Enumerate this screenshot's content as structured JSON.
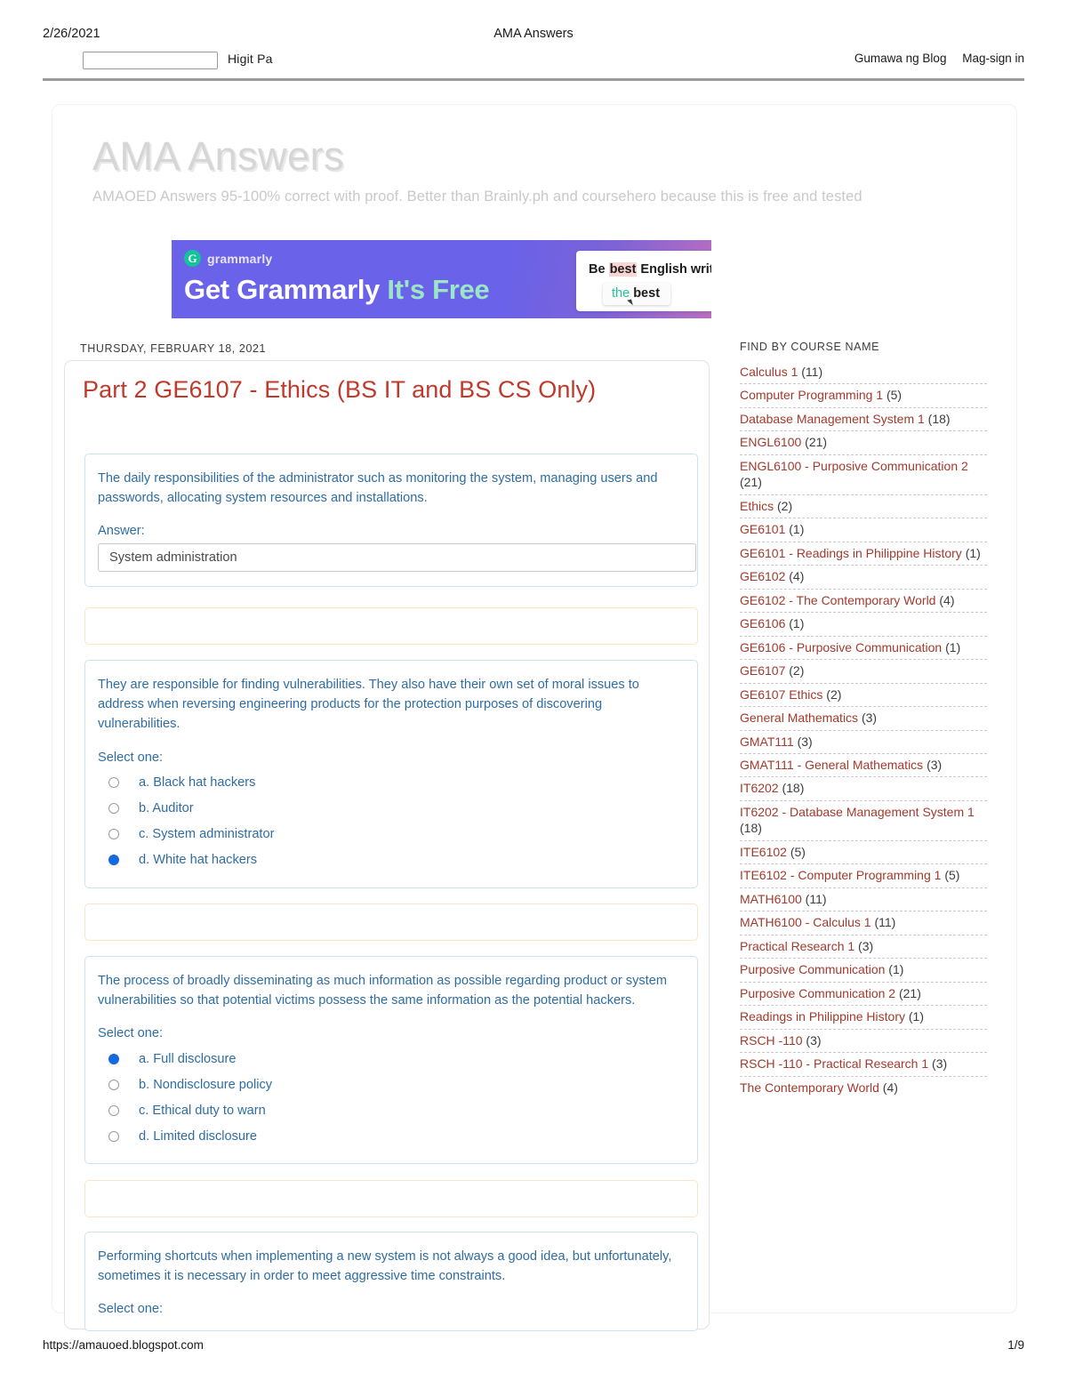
{
  "print_header": {
    "date": "2/26/2021",
    "title": "AMA Answers"
  },
  "navbar": {
    "search_placeholder": "",
    "search_value": "",
    "more_label": "Higit Pa",
    "create_blog_label": "Gumawa ng Blog",
    "sign_in_label": "Mag-sign in"
  },
  "blog": {
    "title": "AMA Answers",
    "description": "AMAOED Answers 95-100% correct with proof. Better than Brainly.ph and coursehero because this is free and tested"
  },
  "ad": {
    "brand": "grammarly",
    "logo_glyph": "G",
    "headline_white": "Get Grammarly",
    "headline_green": "It's Free",
    "card_pre": "Be ",
    "card_highlight": "best",
    "card_post": " English writ",
    "suggest_strike": "the",
    "suggest_bold": "best"
  },
  "post": {
    "date_label": "THURSDAY, FEBRUARY 18, 2021",
    "title": "Part 2 GE6107 - Ethics (BS IT and BS CS Only)",
    "questions": [
      {
        "text": "The daily responsibilities of the administrator such as monitoring the system, managing users and passwords, allocating system resources and installations.",
        "answer_label": "Answer:",
        "answer_value": "System administration",
        "type": "text"
      },
      {
        "text": "They are responsible for finding vulnerabilities. They also have their own set of moral issues to address when reversing engineering products for the protection purposes of discovering vulnerabilities.",
        "select_label": "Select one:",
        "type": "radio",
        "options": [
          {
            "label": "a. Black hat hackers",
            "selected": false
          },
          {
            "label": "b. Auditor",
            "selected": false
          },
          {
            "label": "c. System administrator",
            "selected": false
          },
          {
            "label": "d. White hat hackers",
            "selected": true
          }
        ]
      },
      {
        "text": "The process of broadly disseminating as much information as possible regarding product or system vulnerabilities so that potential victims possess the same information as the potential hackers.",
        "select_label": "Select one:",
        "type": "radio",
        "options": [
          {
            "label": "a. Full disclosure",
            "selected": true
          },
          {
            "label": "b. Nondisclosure policy",
            "selected": false
          },
          {
            "label": "c. Ethical duty to warn",
            "selected": false
          },
          {
            "label": "d. Limited disclosure",
            "selected": false
          }
        ]
      },
      {
        "text": "Performing shortcuts when implementing a new system is not always a good idea, but unfortunately, sometimes it is necessary in order to meet aggressive time constraints.",
        "select_label": "Select one:",
        "type": "radio",
        "options": []
      }
    ]
  },
  "sidebar": {
    "title": "FIND BY COURSE NAME",
    "items": [
      {
        "name": "Calculus 1",
        "count": "(11)"
      },
      {
        "name": "Computer Programming 1",
        "count": "(5)"
      },
      {
        "name": "Database Management System 1",
        "count": "(18)"
      },
      {
        "name": "ENGL6100",
        "count": "(21)"
      },
      {
        "name": "ENGL6100 - Purposive Communication 2",
        "count": "(21)"
      },
      {
        "name": "Ethics",
        "count": "(2)"
      },
      {
        "name": "GE6101",
        "count": "(1)"
      },
      {
        "name": "GE6101 - Readings in Philippine History",
        "count": "(1)"
      },
      {
        "name": "GE6102",
        "count": "(4)"
      },
      {
        "name": "GE6102 - The Contemporary World",
        "count": "(4)"
      },
      {
        "name": "GE6106",
        "count": "(1)"
      },
      {
        "name": "GE6106 - Purposive Communication",
        "count": "(1)"
      },
      {
        "name": "GE6107",
        "count": "(2)"
      },
      {
        "name": "GE6107 Ethics",
        "count": "(2)"
      },
      {
        "name": "General Mathematics",
        "count": "(3)"
      },
      {
        "name": "GMAT111",
        "count": "(3)"
      },
      {
        "name": "GMAT111 - General Mathematics",
        "count": "(3)"
      },
      {
        "name": "IT6202",
        "count": "(18)"
      },
      {
        "name": "IT6202 - Database Management System 1",
        "count": "(18)"
      },
      {
        "name": "ITE6102",
        "count": "(5)"
      },
      {
        "name": "ITE6102 - Computer Programming 1",
        "count": "(5)"
      },
      {
        "name": "MATH6100",
        "count": "(11)"
      },
      {
        "name": "MATH6100 - Calculus 1",
        "count": "(11)"
      },
      {
        "name": "Practical Research 1",
        "count": "(3)"
      },
      {
        "name": "Purposive Communication",
        "count": "(1)"
      },
      {
        "name": "Purposive Communication 2",
        "count": "(21)"
      },
      {
        "name": "Readings in Philippine History",
        "count": "(1)"
      },
      {
        "name": "RSCH -110",
        "count": "(3)"
      },
      {
        "name": "RSCH -110 - Practical Research 1",
        "count": "(3)"
      },
      {
        "name": "The Contemporary World",
        "count": "(4)"
      }
    ]
  },
  "footer": {
    "url": "https://amauoed.blogspot.com",
    "page": "1/9"
  },
  "colors": {
    "link_red": "#a33a2c",
    "title_red": "#c0392b",
    "question_blue": "#2e6da4",
    "radio_selected": "#1769e0",
    "ad_purple": "#6a62e8",
    "ad_green": "#9ae6c6"
  }
}
